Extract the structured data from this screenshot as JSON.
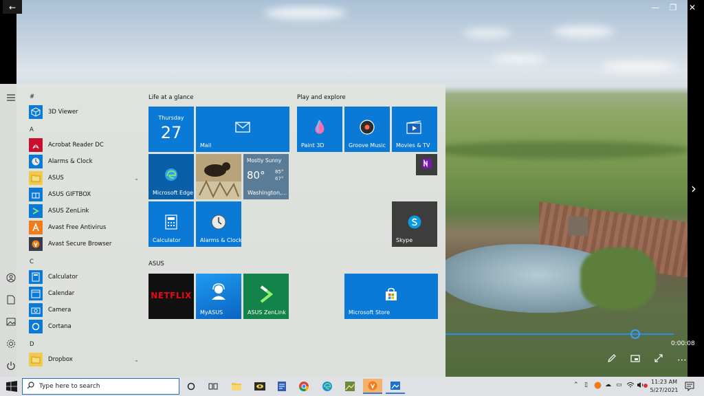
{
  "window": {
    "back_glyph": "←",
    "minimize_glyph": "—",
    "restore_glyph": "❐",
    "close_glyph": "✕",
    "next_glyph": "›"
  },
  "player": {
    "time": "0:00:08",
    "progress": 0.83,
    "controls": [
      "pen-icon",
      "miniview-icon",
      "fullscreen-icon",
      "more-icon"
    ]
  },
  "start_menu": {
    "rail_icons": [
      "hamburger-icon",
      "user-icon",
      "document-icon",
      "pictures-icon",
      "settings-icon",
      "power-icon"
    ],
    "app_list": [
      {
        "type": "letter",
        "text": "#"
      },
      {
        "type": "app",
        "label": "3D Viewer",
        "icon": "cube-icon",
        "color": "#0a7ad6"
      },
      {
        "type": "letter",
        "text": "A"
      },
      {
        "type": "app",
        "label": "Acrobat Reader DC",
        "icon": "acrobat-icon",
        "color": "#c8102e"
      },
      {
        "type": "app",
        "label": "Alarms & Clock",
        "icon": "clock-icon",
        "color": "#0a7ad6"
      },
      {
        "type": "app",
        "label": "ASUS",
        "icon": "folder-icon",
        "color": "#f2c94c",
        "expand": "⌄"
      },
      {
        "type": "app",
        "label": "ASUS GIFTBOX",
        "icon": "gift-icon",
        "color": "#0a7ad6"
      },
      {
        "type": "app",
        "label": "ASUS ZenLink",
        "icon": "zenlink-icon",
        "color": "#0a7ad6"
      },
      {
        "type": "app",
        "label": "Avast Free Antivirus",
        "icon": "avast-icon",
        "color": "#f07b1a"
      },
      {
        "type": "app",
        "label": "Avast Secure Browser",
        "icon": "avast-browser-icon",
        "color": "#f07b1a"
      },
      {
        "type": "letter",
        "text": "C"
      },
      {
        "type": "app",
        "label": "Calculator",
        "icon": "calculator-icon",
        "color": "#0a7ad6"
      },
      {
        "type": "app",
        "label": "Calendar",
        "icon": "calendar-icon",
        "color": "#0a7ad6"
      },
      {
        "type": "app",
        "label": "Camera",
        "icon": "camera-icon",
        "color": "#0a7ad6"
      },
      {
        "type": "app",
        "label": "Cortana",
        "icon": "cortana-icon",
        "color": "#0a7ad6"
      },
      {
        "type": "letter",
        "text": "D"
      },
      {
        "type": "app",
        "label": "Dropbox",
        "icon": "folder-icon",
        "color": "#f2c94c",
        "expand": "⌄"
      }
    ],
    "groups": {
      "life": "Life at a glance",
      "play": "Play and explore",
      "asus": "ASUS"
    },
    "tiles": {
      "calendar": {
        "day": "Thursday",
        "date": "27"
      },
      "mail": "Mail",
      "edge": "Microsoft Edge",
      "weather": {
        "condition": "Mostly Sunny",
        "temp": "80°",
        "high": "85°",
        "low": "67°",
        "city": "Washington,..."
      },
      "calculator": "Calculator",
      "alarms": "Alarms & Clock",
      "paint3d": "Paint 3D",
      "groove": "Groove Music",
      "movies": "Movies & TV",
      "skype": "Skype",
      "netflix": "NETFLIX",
      "myasus": "MyASUS",
      "zenlink": "ASUS ZenLink",
      "store": "Microsoft Store"
    }
  },
  "taskbar": {
    "search_placeholder": "Type here to search",
    "clock_time": "11:23 AM",
    "clock_date": "5/27/2021",
    "colors": {
      "accent": "#0a7ad6",
      "search_border": "#1f6cc2"
    }
  }
}
